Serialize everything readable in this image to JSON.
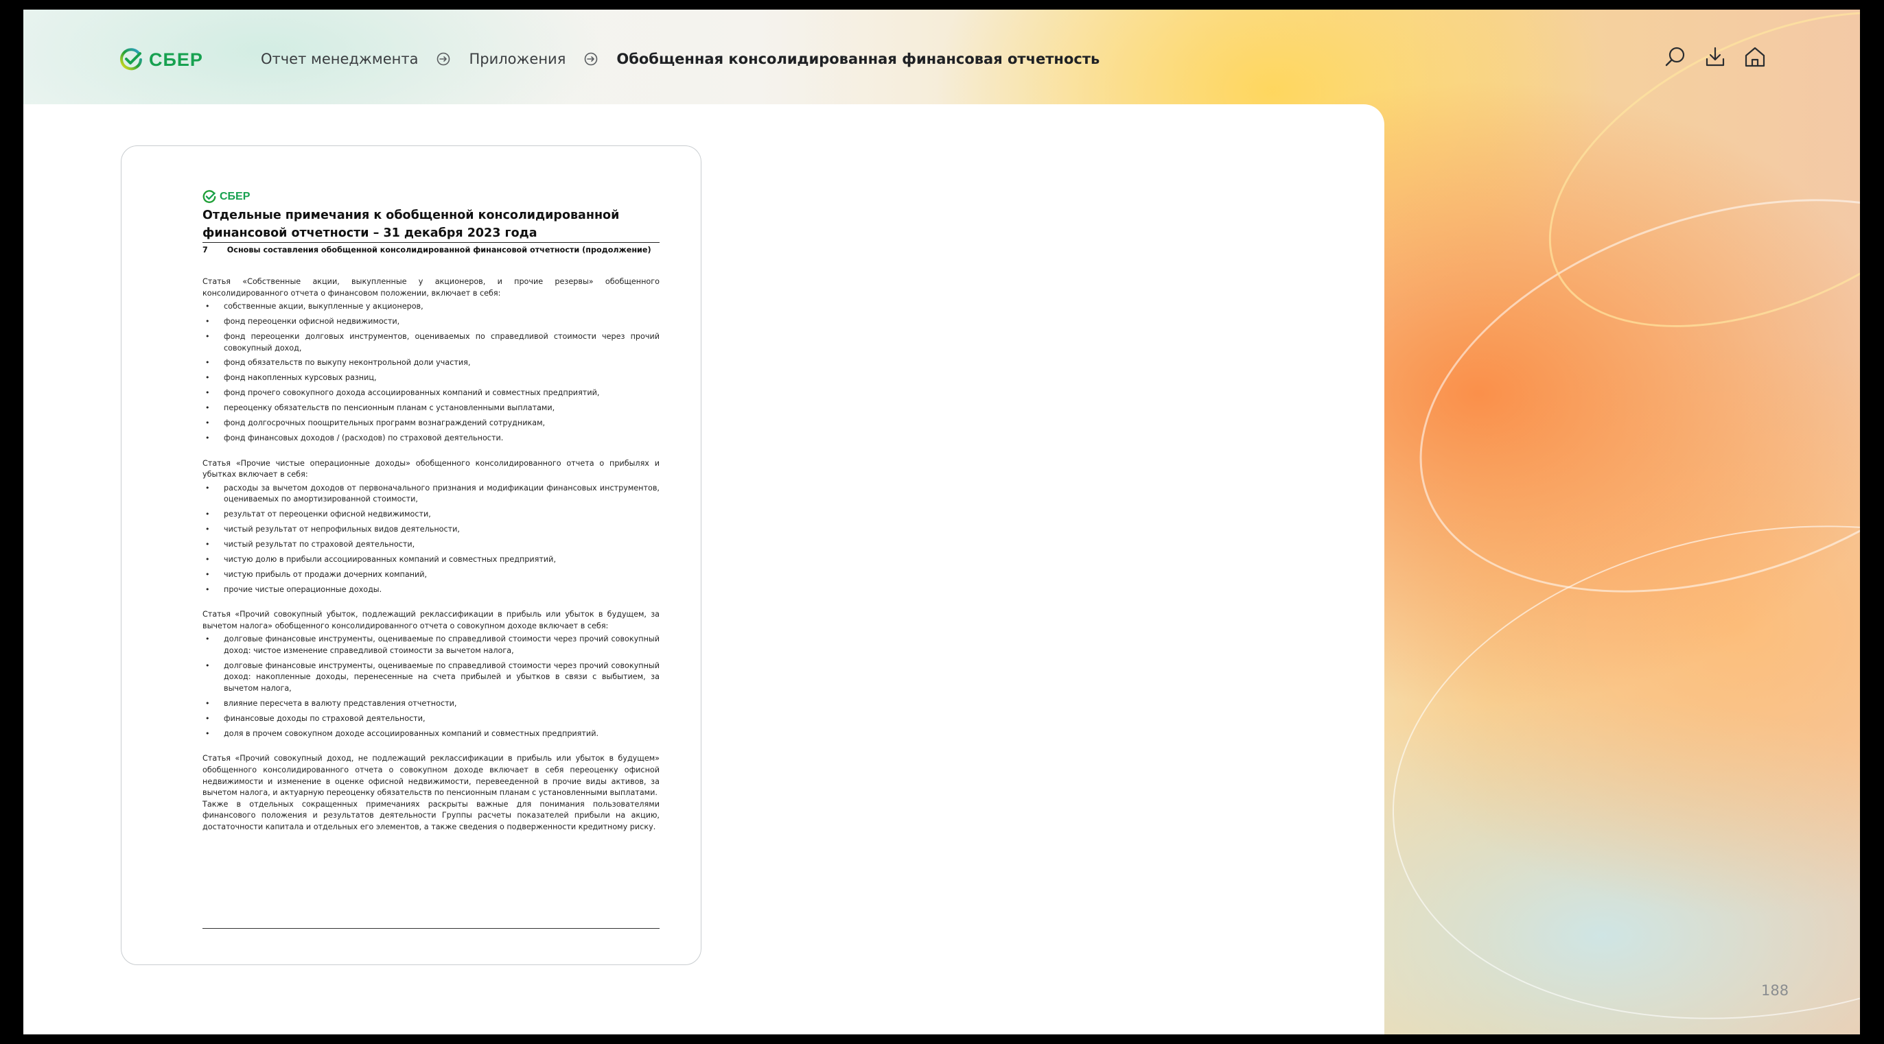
{
  "header": {
    "logo_text": "СБЕР",
    "breadcrumb": [
      {
        "label": "Отчет менеджмента"
      },
      {
        "label": "Приложения"
      },
      {
        "label": "Обобщенная консолидированная финансовая отчетность"
      }
    ],
    "tools": [
      "search-icon",
      "download-icon",
      "home-icon"
    ]
  },
  "document": {
    "logo_text": "СБЕР",
    "title": "Отдельные примечания к обобщенной консолидированной финансовой отчетности – 31 декабря 2023 года",
    "section_number": "7",
    "section_title": "Основы составления обобщенной консолидированной финансовой отчетности (продолжение)",
    "blocks": [
      {
        "intro": "Статья «Собственные акции, выкупленные у акционеров, и прочие резервы» обобщенного консолидированного отчета о финансовом положении, включает в себя:",
        "items": [
          "собственные акции, выкупленные у акционеров,",
          "фонд переоценки офисной недвижимости,",
          "фонд переоценки долговых инструментов, оцениваемых по справедливой стоимости через прочий совокупный доход,",
          "фонд обязательств по выкупу неконтрольной доли участия,",
          "фонд накопленных курсовых разниц,",
          "фонд прочего совокупного дохода ассоциированных компаний и совместных предприятий,",
          "переоценку обязательств по пенсионным планам с установленными выплатами,",
          "фонд долгосрочных поощрительных программ вознаграждений сотрудникам,",
          "фонд финансовых доходов / (расходов) по страховой деятельности."
        ]
      },
      {
        "intro": "Статья «Прочие чистые операционные доходы» обобщенного консолидированного отчета о прибылях и убытках включает в себя:",
        "items": [
          "расходы за вычетом доходов от первоначального признания и модификации финансовых инструментов, оцениваемых по амортизированной стоимости,",
          "результат от переоценки офисной недвижимости,",
          "чистый результат от непрофильных видов деятельности,",
          "чистый результат по страховой деятельности,",
          "чистую долю в прибыли ассоциированных компаний и совместных предприятий,",
          "чистую прибыль от продажи дочерних компаний,",
          "прочие чистые операционные доходы."
        ]
      },
      {
        "intro": "Статья «Прочий совокупный убыток, подлежащий реклассификации в прибыль или убыток в будущем, за вычетом налога» обобщенного консолидированного отчета о совокупном доходе включает в себя:",
        "items": [
          "долговые финансовые инструменты, оцениваемые по справедливой стоимости через прочий совокупный доход: чистое изменение справедливой стоимости за вычетом налога,",
          "долговые финансовые инструменты, оцениваемые по справедливой стоимости через прочий совокупный доход: накопленные доходы, перенесенные на счета прибылей и убытков в связи с выбытием, за вычетом налога,",
          "влияние пересчета в валюту представления отчетности,",
          "финансовые доходы по страховой деятельности,",
          "доля в прочем совокупном доходе ассоциированных компаний и совместных предприятий."
        ]
      }
    ],
    "paragraphs": [
      "Статья «Прочий совокупный доход, не подлежащий реклассификации в прибыль или убыток в будущем» обобщенного консолидированного отчета о совокупном доходе включает в себя переоценку офисной недвижимости и изменение в оценке офисной недвижимости, перевееденной в прочие виды активов, за вычетом налога, и актуарную переоценку обязательств по пенсионным планам с установленными выплатами.",
      "Также в отдельных сокращенных примечаниях раскрыты важные для понимания пользователями финансового положения и результатов деятельности Группы расчеты показателей прибыли на акцию, достаточности капитала и отдельных его элементов, а также сведения о подверженности кредитному риску."
    ]
  },
  "page_number": "188",
  "colors": {
    "brand_green": "#17a150",
    "panel": "#ffffff",
    "accent_orange": "#f5873c"
  }
}
